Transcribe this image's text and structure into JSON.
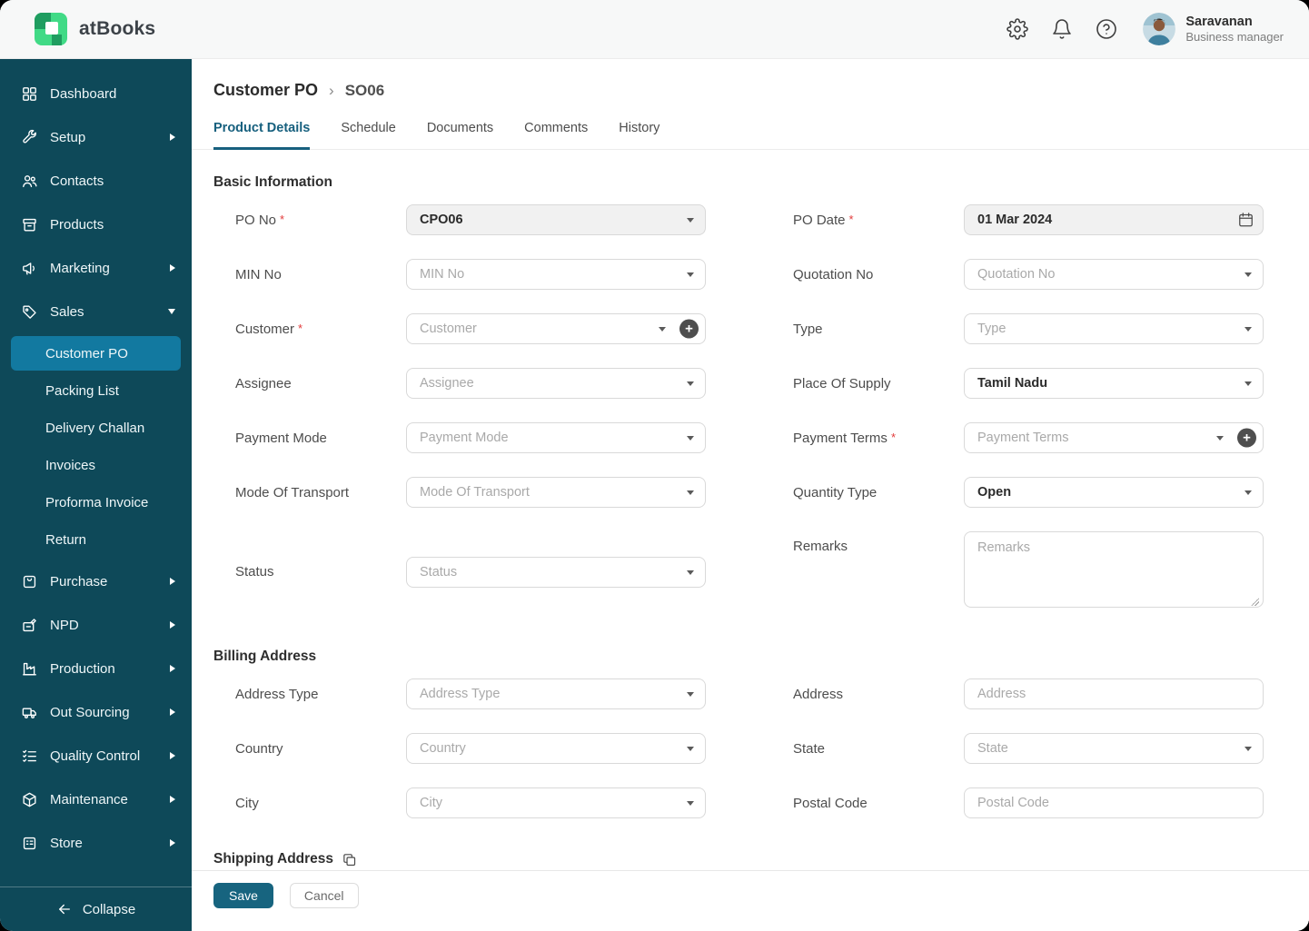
{
  "brand": {
    "name": "atBooks",
    "logo": "atbooks-logo"
  },
  "header": {
    "user": {
      "name": "Saravanan",
      "role": "Business manager"
    },
    "icon_names": [
      "settings-gear-icon",
      "notification-bell-icon",
      "help-icon"
    ]
  },
  "sidebar": {
    "items": [
      {
        "label": "Dashboard",
        "icon": "dashboard-icon"
      },
      {
        "label": "Setup",
        "icon": "wrench-icon",
        "expandable": true
      },
      {
        "label": "Contacts",
        "icon": "contacts-icon"
      },
      {
        "label": "Products",
        "icon": "products-box-icon"
      },
      {
        "label": "Marketing",
        "icon": "megaphone-icon",
        "expandable": true
      },
      {
        "label": "Sales",
        "icon": "tag-icon",
        "expanded": true
      },
      {
        "label": "Customer PO",
        "child": true,
        "active": true
      },
      {
        "label": "Packing List",
        "child": true
      },
      {
        "label": "Delivery Challan",
        "child": true
      },
      {
        "label": "Invoices",
        "child": true
      },
      {
        "label": "Proforma Invoice",
        "child": true
      },
      {
        "label": "Return",
        "child": true
      },
      {
        "label": "Purchase",
        "icon": "bag-icon",
        "expandable": true
      },
      {
        "label": "NPD",
        "icon": "npd-box-icon",
        "expandable": true
      },
      {
        "label": "Production",
        "icon": "factory-icon",
        "expandable": true
      },
      {
        "label": "Out Sourcing",
        "icon": "truck-icon",
        "expandable": true
      },
      {
        "label": "Quality Control",
        "icon": "checklist-icon",
        "expandable": true
      },
      {
        "label": "Maintenance",
        "icon": "cube-icon",
        "expandable": true
      },
      {
        "label": "Store",
        "icon": "store-icon",
        "expandable": true
      }
    ],
    "collapse_label": "Collapse"
  },
  "breadcrumb": {
    "parent": "Customer PO",
    "separator": "›",
    "current": "SO06"
  },
  "tabs": [
    {
      "label": "Product Details",
      "active": true
    },
    {
      "label": "Schedule"
    },
    {
      "label": "Documents"
    },
    {
      "label": "Comments"
    },
    {
      "label": "History"
    }
  ],
  "form": {
    "required_marker": "*",
    "sections": {
      "basic": {
        "title": "Basic Information"
      },
      "billing": {
        "title": "Billing Address"
      },
      "shipping": {
        "title": "Shipping Address",
        "icon": "copy-icon"
      }
    },
    "fields": {
      "po_no": {
        "label": "PO No",
        "value": "CPO06",
        "required": true
      },
      "po_date": {
        "label": "PO Date",
        "value": "01 Mar 2024",
        "required": true
      },
      "min_no": {
        "label": "MIN No",
        "placeholder": "MIN No"
      },
      "quotation_no": {
        "label": "Quotation No",
        "placeholder": "Quotation No"
      },
      "customer": {
        "label": "Customer",
        "placeholder": "Customer",
        "required": true
      },
      "type": {
        "label": "Type",
        "placeholder": "Type"
      },
      "assignee": {
        "label": "Assignee",
        "placeholder": "Assignee"
      },
      "place_of_supply": {
        "label": "Place Of Supply",
        "value": "Tamil Nadu"
      },
      "payment_mode": {
        "label": "Payment Mode",
        "placeholder": "Payment Mode"
      },
      "payment_terms": {
        "label": "Payment Terms",
        "placeholder": "Payment Terms",
        "required": true
      },
      "mode_of_transport": {
        "label": "Mode Of Transport",
        "placeholder": "Mode Of Transport"
      },
      "quantity_type": {
        "label": "Quantity Type",
        "value": "Open"
      },
      "status": {
        "label": "Status",
        "placeholder": "Status"
      },
      "remarks": {
        "label": "Remarks",
        "placeholder": "Remarks"
      },
      "address_type": {
        "label": "Address Type",
        "placeholder": "Address Type"
      },
      "address": {
        "label": "Address",
        "placeholder": "Address"
      },
      "country": {
        "label": "Country",
        "placeholder": "Country"
      },
      "state": {
        "label": "State",
        "placeholder": "State"
      },
      "city": {
        "label": "City",
        "placeholder": "City"
      },
      "postal_code": {
        "label": "Postal Code",
        "placeholder": "Postal Code"
      }
    }
  },
  "footer": {
    "save_label": "Save",
    "cancel_label": "Cancel"
  },
  "colors": {
    "sidebar_bg": "#0e4959",
    "sidebar_active_bg": "#1279a0",
    "accent_teal": "#17647f",
    "logo_green_light": "#41da86",
    "logo_green_dark": "#1f9d60",
    "required_red": "#e23b3b",
    "header_bg": "#f7f8f8"
  }
}
